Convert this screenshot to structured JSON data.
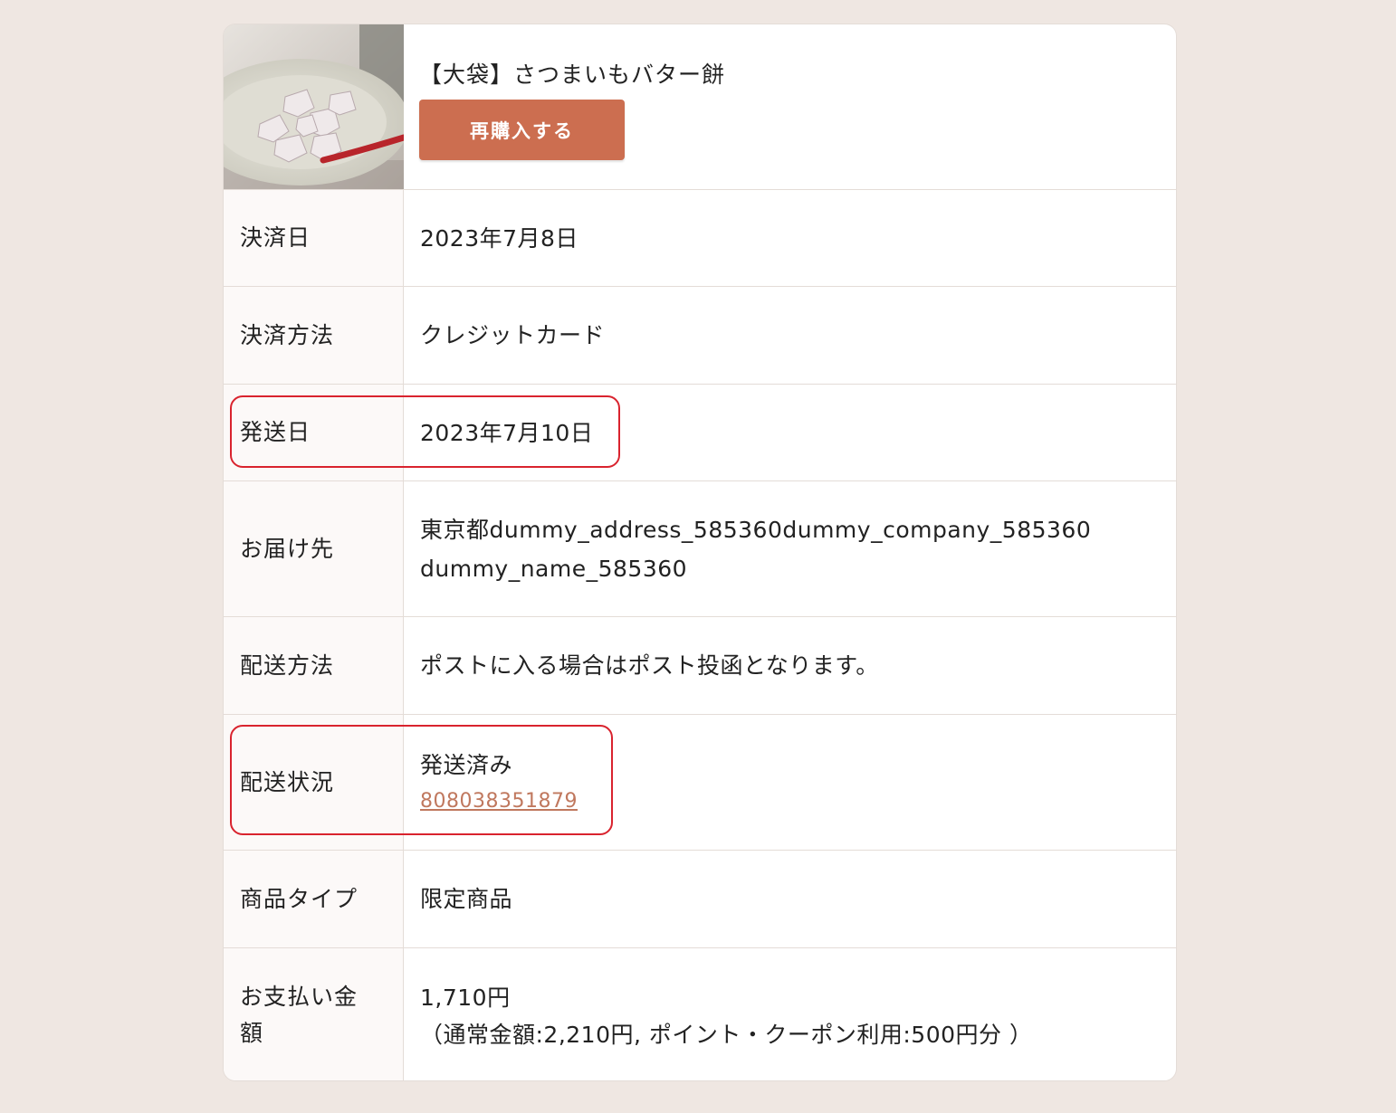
{
  "product": {
    "image": "sweet-potato-butter-mochi-photo",
    "title": "【大袋】さつまいもバター餅",
    "rebuy_label": "再購入する"
  },
  "rows": [
    {
      "label": "決済日",
      "value": "2023年7月8日"
    },
    {
      "label": "決済方法",
      "value": "クレジットカード"
    },
    {
      "label": "発送日",
      "value": "2023年7月10日"
    },
    {
      "label": "お届け先",
      "value_line1": "東京都dummy_address_585360dummy_company_585360",
      "value_line2": "dummy_name_585360"
    },
    {
      "label": "配送方法",
      "value": "ポストに入る場合はポスト投函となります。"
    },
    {
      "label": "配送状況",
      "value": "発送済み",
      "tracking_number": "808038351879"
    },
    {
      "label": "商品タイプ",
      "value": "限定商品"
    },
    {
      "label_line1": "お支払い金",
      "label_line2": "額",
      "value_line1": "1,710円",
      "value_line2": "（通常金額:2,210円, ポイント・クーポン利用:500円分 ）"
    }
  ],
  "colors": {
    "background": "#efe7e2",
    "accent_button": "#cc6e50",
    "link": "#c0785e",
    "highlight": "#d9232e"
  }
}
